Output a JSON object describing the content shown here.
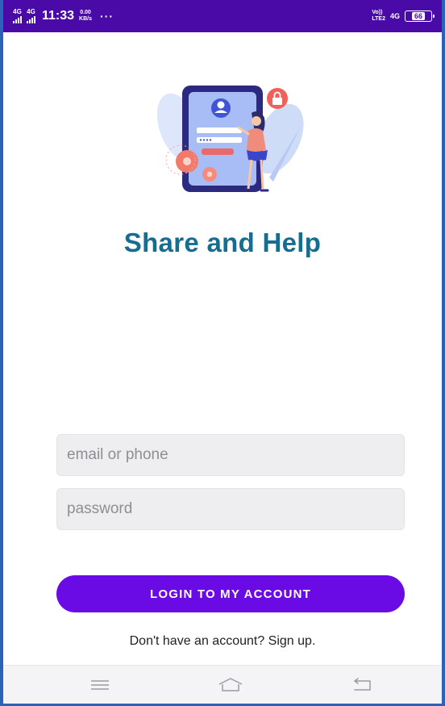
{
  "status_bar": {
    "network_1": "4G",
    "network_2": "4G",
    "time": "11:33",
    "speed_value": "0.00",
    "speed_unit": "KB/s",
    "more": "···",
    "volte_top": "Vo))",
    "volte_bottom": "LTE2",
    "network_right": "4G",
    "battery_level": "66",
    "background_color": "#4a0aa8"
  },
  "app": {
    "title": "Share and Help",
    "title_color": "#176d91"
  },
  "form": {
    "email_placeholder": "email or phone",
    "email_value": "",
    "password_placeholder": "password",
    "password_value": "",
    "login_label": "LOGIN TO MY ACCOUNT",
    "login_color": "#6a0be6",
    "signup_text": "Don't have an account? Sign up."
  },
  "nav": {
    "menu_icon": "menu-lines-icon",
    "home_icon": "home-icon",
    "back_icon": "back-icon"
  }
}
